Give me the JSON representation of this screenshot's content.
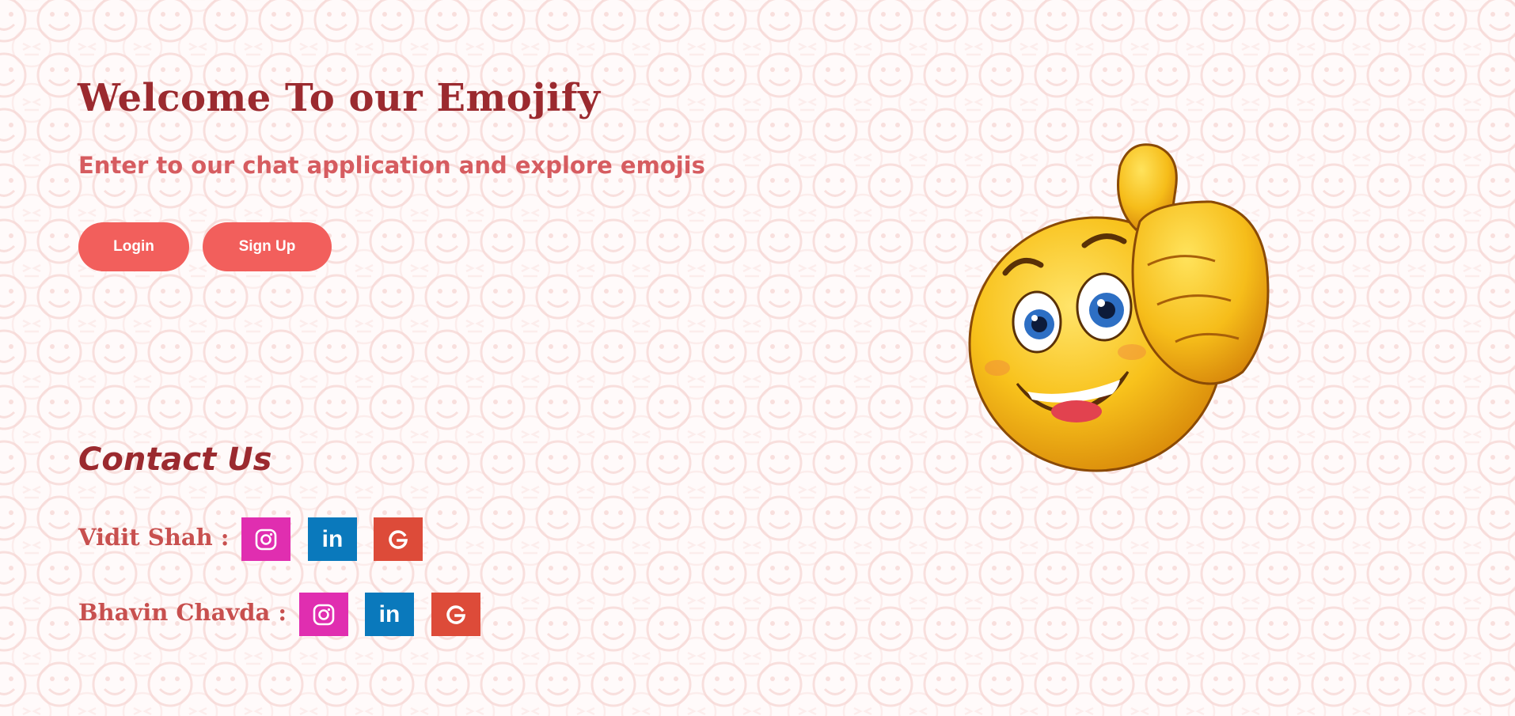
{
  "hero": {
    "title": "Welcome To our Emojify",
    "subtitle": "Enter to our chat application and explore emojis",
    "login_label": "Login",
    "signup_label": "Sign Up"
  },
  "contact": {
    "heading": "Contact Us",
    "people": [
      {
        "name": "Vidit Shah :",
        "links": [
          "instagram-icon",
          "linkedin-icon",
          "google-icon"
        ]
      },
      {
        "name": "Bhavin Chavda :",
        "links": [
          "instagram-icon",
          "linkedin-icon",
          "google-icon"
        ]
      }
    ]
  },
  "social_labels": {
    "linkedin": "in"
  },
  "colors": {
    "title": "#9b2a2f",
    "subtitle": "#d65c60",
    "button": "#f25f5c",
    "instagram": "#e02eb0",
    "linkedin": "#0a79bc",
    "google": "#dd4b39"
  },
  "illustration": "thumbs-up-smiley-emoji"
}
